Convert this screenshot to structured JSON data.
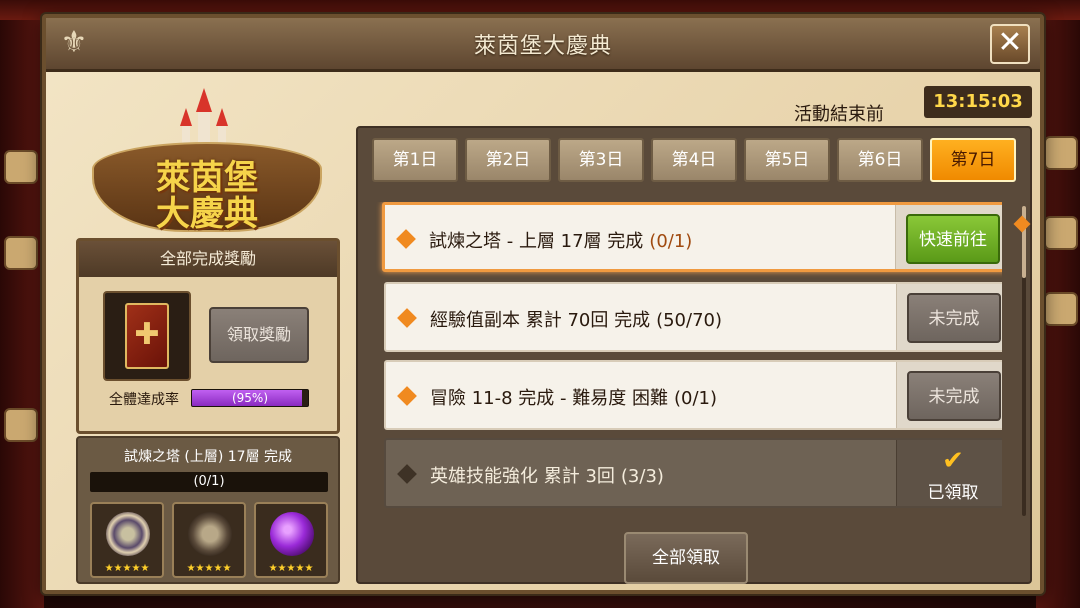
{
  "window": {
    "title": "萊茵堡大慶典",
    "close_icon": "close-icon"
  },
  "event": {
    "ends_label": "活動結束前",
    "time_remaining": "13:15:03",
    "logo_line1": "萊茵堡",
    "logo_line2": "大慶典"
  },
  "all_complete": {
    "header": "全部完成獎勵",
    "claim_label": "領取獎勵",
    "rate_label": "全體達成率",
    "rate_text": "(95%)",
    "rate_value": 0.95
  },
  "featured_mission": {
    "title": "試煉之塔 (上層) 17層 完成",
    "progress": "(0/1)",
    "rewards": [
      {
        "name": "ring-item-icon",
        "stars": "★★★★★"
      },
      {
        "name": "skull-item-icon",
        "stars": "★★★★★"
      },
      {
        "name": "orb-item-icon",
        "stars": "★★★★★"
      }
    ]
  },
  "tabs": [
    {
      "label": "第1日",
      "active": false
    },
    {
      "label": "第2日",
      "active": false
    },
    {
      "label": "第3日",
      "active": false
    },
    {
      "label": "第4日",
      "active": false
    },
    {
      "label": "第5日",
      "active": false
    },
    {
      "label": "第6日",
      "active": false
    },
    {
      "label": "第7日",
      "active": true
    }
  ],
  "missions": [
    {
      "text": "試煉之塔 - 上層 17層 完成",
      "progress": "(0/1)",
      "status": "go",
      "button": "快速前往"
    },
    {
      "text": "經驗值副本 累計 70回 完成",
      "progress": "(50/70)",
      "status": "incomplete",
      "button": "未完成"
    },
    {
      "text": "冒險 11-8 完成 - 難易度 困難",
      "progress": "(0/1)",
      "status": "incomplete",
      "button": "未完成"
    },
    {
      "text": "英雄技能強化 累計 3回",
      "progress": "(3/3)",
      "status": "claimed",
      "button": "已領取"
    }
  ],
  "footer": {
    "claim_all_label": "全部領取"
  },
  "colors": {
    "accent": "#f08a00",
    "go_button": "#6aaa22",
    "timer_text": "#ffd84a",
    "progress_purple": "#a040d8"
  }
}
